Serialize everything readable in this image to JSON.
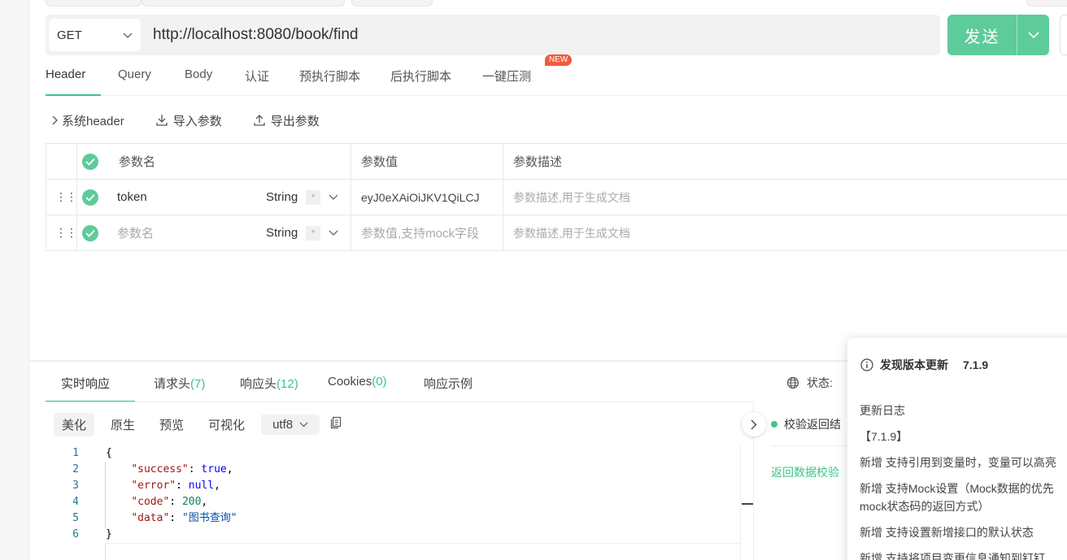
{
  "request": {
    "method": "GET",
    "url": "http://localhost:8080/book/find",
    "send_label": "发送"
  },
  "request_tabs": [
    {
      "label": "Header"
    },
    {
      "label": "Query"
    },
    {
      "label": "Body"
    },
    {
      "label": "认证"
    },
    {
      "label": "预执行脚本"
    },
    {
      "label": "后执行脚本"
    },
    {
      "label": "一键压测"
    }
  ],
  "new_badge": "NEW",
  "toolbar": {
    "system_header": "系统header",
    "import_label": "导入参数",
    "export_label": "导出参数"
  },
  "params_table": {
    "headers": {
      "name": "参数名",
      "value": "参数值",
      "desc": "参数描述"
    },
    "rows": [
      {
        "name": "token",
        "type": "String",
        "required": "*",
        "value": "eyJ0eXAiOiJKV1QiLCJ",
        "desc_placeholder": "参数描述,用于生成文档"
      },
      {
        "name_placeholder": "参数名",
        "type": "String",
        "required": "*",
        "value_placeholder": "参数值,支持mock字段",
        "desc_placeholder": "参数描述,用于生成文档"
      }
    ]
  },
  "response_tabs": [
    {
      "label": "实时响应",
      "count": ""
    },
    {
      "label": "请求头",
      "count": "(7)"
    },
    {
      "label": "响应头",
      "count": "(12)"
    },
    {
      "label": "Cookies",
      "count": "(0)"
    },
    {
      "label": "响应示例",
      "count": ""
    }
  ],
  "status_label": "状态:",
  "view_modes": [
    "美化",
    "原生",
    "预览",
    "可视化"
  ],
  "charset": "utf8",
  "code_lines": [
    {
      "n": "1",
      "parts": [
        {
          "t": "{",
          "c": ""
        }
      ]
    },
    {
      "n": "2",
      "parts": [
        {
          "t": "    ",
          "c": ""
        },
        {
          "t": "\"success\"",
          "c": "key"
        },
        {
          "t": ": ",
          "c": ""
        },
        {
          "t": "true",
          "c": "kw"
        },
        {
          "t": ",",
          "c": ""
        }
      ]
    },
    {
      "n": "3",
      "parts": [
        {
          "t": "    ",
          "c": ""
        },
        {
          "t": "\"error\"",
          "c": "key"
        },
        {
          "t": ": ",
          "c": ""
        },
        {
          "t": "null",
          "c": "kw"
        },
        {
          "t": ",",
          "c": ""
        }
      ]
    },
    {
      "n": "4",
      "parts": [
        {
          "t": "    ",
          "c": ""
        },
        {
          "t": "\"code\"",
          "c": "key"
        },
        {
          "t": ": ",
          "c": ""
        },
        {
          "t": "200",
          "c": "num"
        },
        {
          "t": ",",
          "c": ""
        }
      ]
    },
    {
      "n": "5",
      "parts": [
        {
          "t": "    ",
          "c": ""
        },
        {
          "t": "\"data\"",
          "c": "key"
        },
        {
          "t": ": ",
          "c": ""
        },
        {
          "t": "\"图书查询\"",
          "c": "str"
        }
      ]
    },
    {
      "n": "6",
      "parts": [
        {
          "t": "}",
          "c": ""
        }
      ]
    }
  ],
  "validation": {
    "title": "校验返回结",
    "link": "返回数据校验"
  },
  "update_notice": {
    "title": "发现版本更新",
    "version": "7.1.9",
    "log_title": "更新日志",
    "log_version": "【7.1.9】",
    "items": [
      "新增 支持引用到变量时，变量可以高亮",
      "新增 支持Mock设置（Mock数据的优先 mock状态码的返回方式）",
      "新增 支持设置新增接口的默认状态",
      "新增 支持将项目变更信息通知到钉钉"
    ]
  },
  "colors": {
    "accent": "#5ecb9a",
    "accent_text": "#3cc587",
    "badge": "#f25a3c"
  }
}
